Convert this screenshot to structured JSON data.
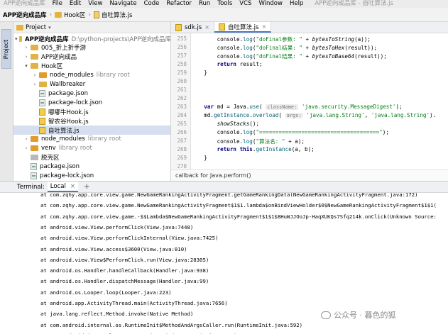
{
  "menu": [
    "APP逆向成品库",
    "File",
    "Edit",
    "View",
    "Navigate",
    "Code",
    "Refactor",
    "Run",
    "Tools",
    "VCS",
    "Window",
    "Help",
    "APP逆向成品库 - 自吐算法.js"
  ],
  "breadcrumb": {
    "project": "APP逆向成品库",
    "folder": "Hook区",
    "file": "自吐算法.js"
  },
  "stripe_label": "Project",
  "project_panel": {
    "title": "Project",
    "tree": [
      {
        "label": "APP逆向成品库",
        "hint": "D:\\python-projects\\APP逆向成品库",
        "type": "folder",
        "arrow": "▾"
      },
      {
        "label": "005_折上折手游",
        "hint": "",
        "type": "folder",
        "arrow": "›"
      },
      {
        "label": "APP逆向成品",
        "hint": "",
        "type": "folder",
        "arrow": "›"
      },
      {
        "label": "Hook区",
        "hint": "",
        "type": "folder",
        "arrow": "▾"
      },
      {
        "label": "node_modules",
        "hint": "library root",
        "type": "folder-orange",
        "arrow": "›"
      },
      {
        "label": "Wallbreaker",
        "hint": "",
        "type": "folder",
        "arrow": "›"
      },
      {
        "label": "package.json",
        "hint": "",
        "type": "json",
        "arrow": ""
      },
      {
        "label": "package-lock.json",
        "hint": "",
        "type": "json",
        "arrow": ""
      },
      {
        "label": "嘟嘟牛Hook.js",
        "hint": "",
        "type": "js",
        "arrow": ""
      },
      {
        "label": "智农谷Hook.js",
        "hint": "",
        "type": "js",
        "arrow": ""
      },
      {
        "label": "自吐算法.js",
        "hint": "",
        "type": "js",
        "arrow": "",
        "selected": true
      },
      {
        "label": "node_modules",
        "hint": "library root",
        "type": "folder-orange",
        "arrow": "›"
      },
      {
        "label": "venv",
        "hint": "library root",
        "type": "folder-orange",
        "arrow": "›"
      },
      {
        "label": "脱壳区",
        "hint": "",
        "type": "file",
        "arrow": ""
      },
      {
        "label": "package.json",
        "hint": "",
        "type": "json",
        "arrow": ""
      },
      {
        "label": "package-lock.json",
        "hint": "",
        "type": "json",
        "arrow": ""
      }
    ]
  },
  "editor": {
    "tabs": [
      {
        "label": "sdk.js",
        "active": false
      },
      {
        "label": "自吐算法.js",
        "active": true
      }
    ],
    "line_numbers": [
      "255",
      "256",
      "257",
      "258",
      "259",
      "260",
      "261",
      "262",
      "263",
      "264",
      "265",
      "266",
      "267",
      "268",
      "269",
      "270"
    ],
    "code_lines": [
      {
        "text": "        console.log(\"doFinal参数: \" + bytesToString(a));"
      },
      {
        "text": "        console.log(\"doFinal结果: \" + bytesToHex(result));"
      },
      {
        "text": "        console.log(\"doFinal结果: \" + bytesToBase64(result));"
      },
      {
        "text": "        return result;"
      },
      {
        "text": "    }"
      },
      {
        "text": ""
      },
      {
        "text": ""
      },
      {
        "text": ""
      },
      {
        "text": "    var md = Java.use( className: 'java.security.MessageDigest');"
      },
      {
        "text": "    md.getInstance.overload( args: 'java.lang.String', 'java.lang.String')."
      },
      {
        "text": "        showStacks();"
      },
      {
        "text": "        console.log(\"=====================================\");"
      },
      {
        "text": "        console.log(\"算法名: \" + a);"
      },
      {
        "text": "        return this.getInstance(a, b);"
      },
      {
        "text": "    }"
      },
      {
        "text": ""
      }
    ],
    "status_crumb": "callback for Java.perform()"
  },
  "terminal": {
    "title": "Terminal:",
    "tab": "Local",
    "lines": [
      "at com.zqhy.app.core.view.game.NewGameRankingActivityFragment.getGameRankingData(NewGameRankingActivityFragment.java:172)",
      "at com.zqhy.app.core.view.game.NewGameRankingActivityFragment$1$1.lambda$onBindViewHolder$0$NewGameRankingActivityFragment$1$1(",
      "at com.zqhy.app.core.view.game.-$$Lambda$NewGameRankingActivityFragment$1$1$8HuWJJOoJp-HaqXUKQs7Sfq214k.onClick(Unknown Source:",
      "at android.view.View.performClick(View.java:7448)",
      "at android.view.View.performClickInternal(View.java:7425)",
      "at android.view.View.access$3600(View.java:810)",
      "at android.view.View$PerformClick.run(View.java:28305)",
      "at android.os.Handler.handleCallback(Handler.java:938)",
      "at android.os.Handler.dispatchMessage(Handler.java:99)",
      "at android.os.Looper.loop(Looper.java:223)",
      "at android.app.ActivityThread.main(ActivityThread.java:7656)",
      "at java.lang.reflect.Method.invoke(Native Method)",
      "at com.android.internal.os.RuntimeInit$MethodAndArgsCaller.run(RuntimeInit.java:592)",
      "at com.android.internal.os.ZygoteInit.main(ZygoteInit.java:947)"
    ]
  },
  "watermark": "公众号 · 暮色的狐"
}
